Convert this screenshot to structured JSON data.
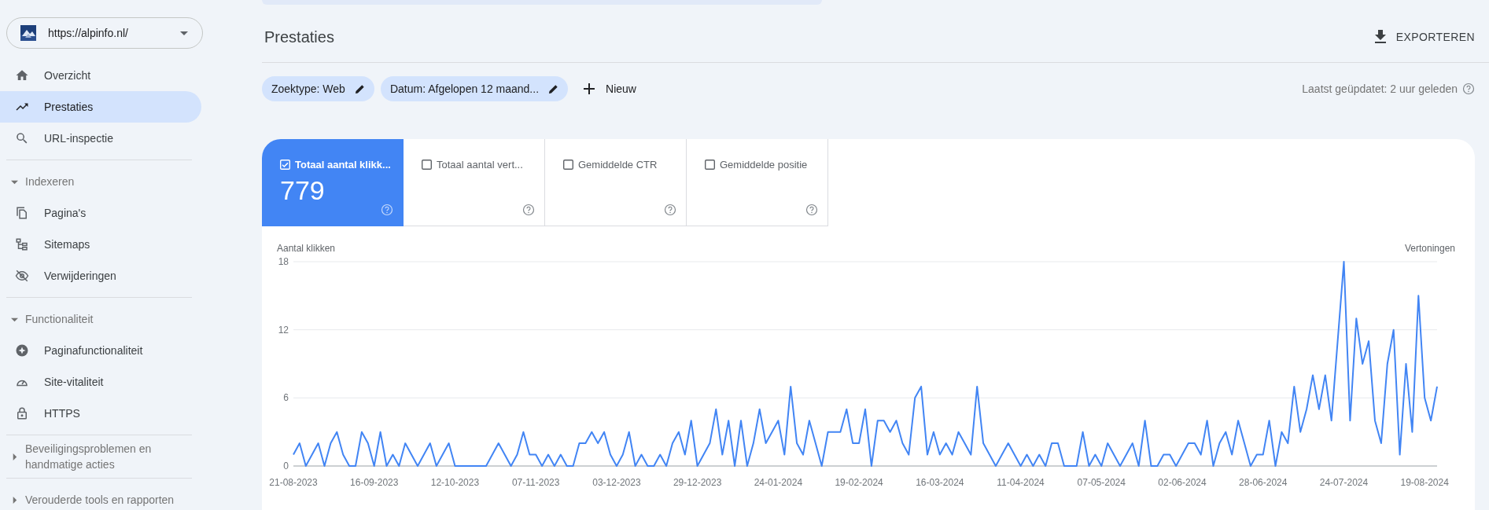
{
  "sidebar": {
    "property": "https://alpinfo.nl/",
    "items": [
      {
        "label": "Overzicht",
        "selected": false
      },
      {
        "label": "Prestaties",
        "selected": true
      },
      {
        "label": "URL-inspectie",
        "selected": false
      }
    ],
    "sections": [
      {
        "label": "Indexeren",
        "expanded": true,
        "items": [
          {
            "label": "Pagina's",
            "selected": false
          },
          {
            "label": "Sitemaps",
            "selected": false
          },
          {
            "label": "Verwijderingen",
            "selected": false
          }
        ]
      },
      {
        "label": "Functionaliteit",
        "expanded": true,
        "items": [
          {
            "label": "Paginafunctionaliteit",
            "selected": false
          },
          {
            "label": "Site-vitaliteit",
            "selected": false
          },
          {
            "label": "HTTPS",
            "selected": false
          }
        ]
      },
      {
        "label": "Beveiligingsproblemen en handmatige acties",
        "expanded": false
      },
      {
        "label": "Verouderde tools en rapporten",
        "expanded": false
      }
    ]
  },
  "header": {
    "title": "Prestaties",
    "export": "EXPORTEREN"
  },
  "filters": [
    {
      "label": "Zoektype: Web"
    },
    {
      "label": "Datum: Afgelopen 12 maand..."
    }
  ],
  "new_filter": "Nieuw",
  "last_updated": "Laatst geüpdatet: 2 uur geleden",
  "metrics": [
    {
      "label": "Totaal aantal klikk...",
      "selected": true,
      "value": "779"
    },
    {
      "label": "Totaal aantal vert...",
      "selected": false
    },
    {
      "label": "Gemiddelde CTR",
      "selected": false
    },
    {
      "label": "Gemiddelde positie",
      "selected": false
    }
  ],
  "chart": {
    "right_label": "Vertoningen",
    "chart_data": {
      "type": "line",
      "ylim": [
        0,
        18
      ],
      "yticks": [
        0,
        6,
        12,
        18
      ],
      "categories": [
        "21-08-2023",
        null,
        null,
        null,
        null,
        null,
        null,
        null,
        null,
        null,
        null,
        null,
        null,
        "16-09-2023",
        null,
        null,
        null,
        null,
        null,
        null,
        null,
        null,
        null,
        null,
        null,
        null,
        "12-10-2023",
        null,
        null,
        null,
        null,
        null,
        null,
        null,
        null,
        null,
        null,
        null,
        null,
        "07-11-2023",
        null,
        null,
        null,
        null,
        null,
        null,
        null,
        null,
        null,
        null,
        null,
        null,
        "03-12-2023",
        null,
        null,
        null,
        null,
        null,
        null,
        null,
        null,
        null,
        null,
        null,
        null,
        "29-12-2023",
        null,
        null,
        null,
        null,
        null,
        null,
        null,
        null,
        null,
        null,
        null,
        null,
        "24-01-2024",
        null,
        null,
        null,
        null,
        null,
        null,
        null,
        null,
        null,
        null,
        null,
        null,
        "19-02-2024",
        null,
        null,
        null,
        null,
        null,
        null,
        null,
        null,
        null,
        null,
        null,
        null,
        "16-03-2024",
        null,
        null,
        null,
        null,
        null,
        null,
        null,
        null,
        null,
        null,
        null,
        null,
        "11-04-2024",
        null,
        null,
        null,
        null,
        null,
        null,
        null,
        null,
        null,
        null,
        null,
        null,
        "07-05-2024",
        null,
        null,
        null,
        null,
        null,
        null,
        null,
        null,
        null,
        null,
        null,
        null,
        "02-06-2024",
        null,
        null,
        null,
        null,
        null,
        null,
        null,
        null,
        null,
        null,
        null,
        null,
        "28-06-2024",
        null,
        null,
        null,
        null,
        null,
        null,
        null,
        null,
        null,
        null,
        null,
        null,
        "24-07-2024",
        null,
        null,
        null,
        null,
        null,
        null,
        null,
        null,
        null,
        null,
        null,
        null,
        "19-08-2024",
        null,
        null
      ],
      "series": [
        {
          "name": "Aantal klikken",
          "color": "#4285f4",
          "values": [
            1,
            2,
            0,
            1,
            2,
            0,
            2,
            3,
            1,
            0,
            0,
            3,
            2,
            0,
            3,
            0,
            1,
            0,
            2,
            1,
            0,
            1,
            2,
            0,
            1,
            2,
            0,
            0,
            0,
            0,
            0,
            0,
            1,
            2,
            1,
            0,
            1,
            3,
            1,
            1,
            0,
            1,
            0,
            1,
            0,
            0,
            2,
            2,
            3,
            2,
            3,
            1,
            0,
            1,
            3,
            0,
            1,
            0,
            0,
            1,
            0,
            2,
            3,
            1,
            4,
            0,
            1,
            2,
            5,
            1,
            4,
            0,
            4,
            0,
            2,
            5,
            2,
            3,
            4,
            1,
            7,
            2,
            1,
            4,
            2,
            0,
            3,
            3,
            3,
            5,
            2,
            2,
            5,
            0,
            4,
            4,
            3,
            4,
            2,
            1,
            6,
            7,
            1,
            3,
            1,
            2,
            1,
            3,
            2,
            1,
            7,
            2,
            1,
            0,
            1,
            2,
            1,
            0,
            1,
            0,
            1,
            0,
            2,
            2,
            0,
            0,
            0,
            3,
            0,
            1,
            0,
            2,
            1,
            0,
            1,
            2,
            0,
            4,
            0,
            0,
            1,
            1,
            0,
            1,
            2,
            2,
            1,
            4,
            0,
            2,
            3,
            1,
            4,
            2,
            0,
            1,
            1,
            4,
            0,
            3,
            2,
            7,
            3,
            5,
            8,
            5,
            8,
            4,
            11,
            18,
            4,
            13,
            9,
            11,
            4,
            2,
            9,
            12,
            1,
            9,
            3,
            15,
            6,
            4,
            7
          ]
        }
      ]
    }
  }
}
